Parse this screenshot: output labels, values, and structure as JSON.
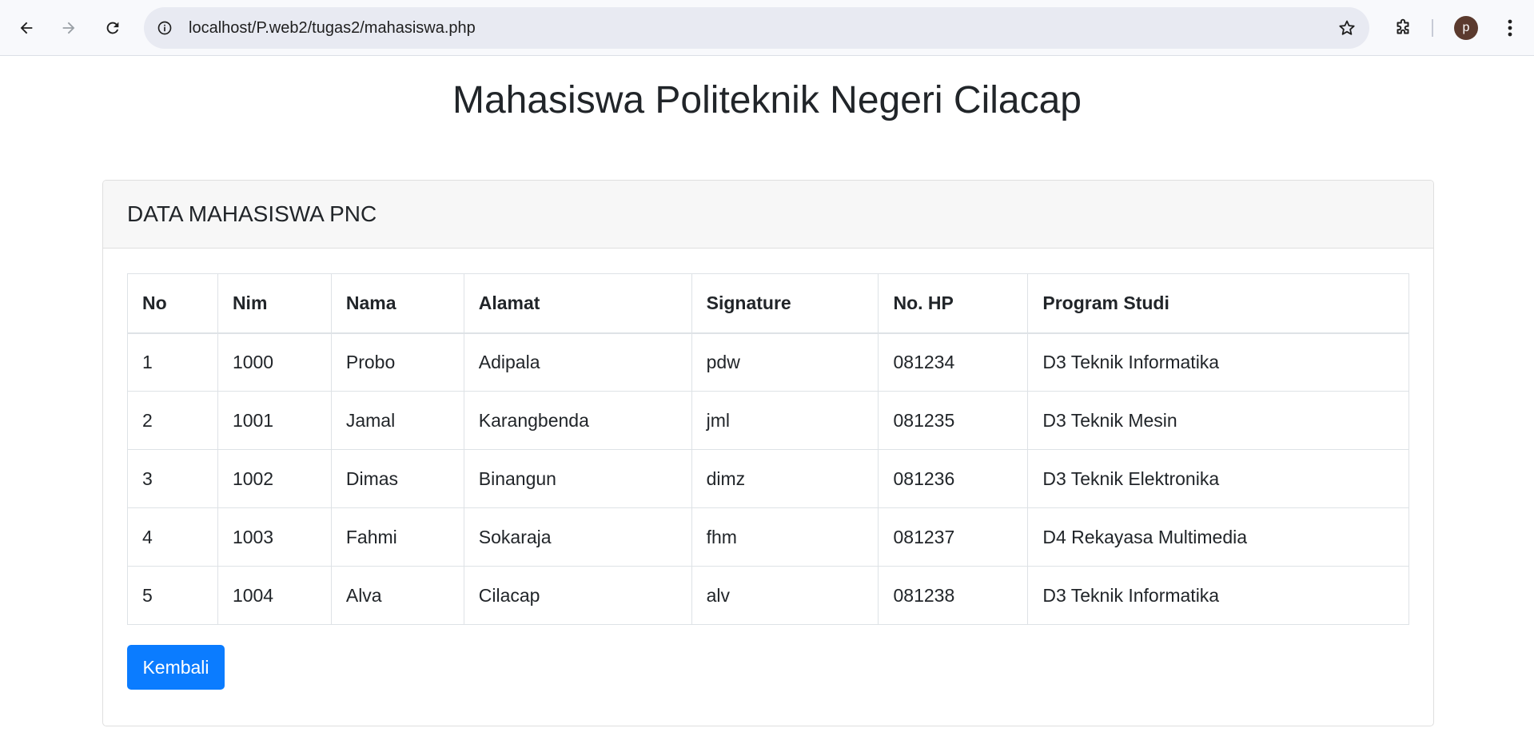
{
  "browser": {
    "url": "localhost/P.web2/tugas2/mahasiswa.php",
    "profile_initial": "p",
    "icons": {
      "back": "back-arrow-icon",
      "forward": "forward-arrow-icon",
      "reload": "reload-icon",
      "site_info": "site-info-icon",
      "bookmark": "star-icon",
      "extensions": "puzzle-icon",
      "menu": "kebab-menu-icon"
    }
  },
  "page": {
    "title": "Mahasiswa Politeknik Negeri Cilacap"
  },
  "card": {
    "header": "DATA MAHASISWA PNC",
    "table": {
      "columns": [
        "No",
        "Nim",
        "Nama",
        "Alamat",
        "Signature",
        "No. HP",
        "Program Studi"
      ],
      "rows": [
        [
          "1",
          "1000",
          "Probo",
          "Adipala",
          "pdw",
          "081234",
          "D3 Teknik Informatika"
        ],
        [
          "2",
          "1001",
          "Jamal",
          "Karangbenda",
          "jml",
          "081235",
          "D3 Teknik Mesin"
        ],
        [
          "3",
          "1002",
          "Dimas",
          "Binangun",
          "dimz",
          "081236",
          "D3 Teknik Elektronika"
        ],
        [
          "4",
          "1003",
          "Fahmi",
          "Sokaraja",
          "fhm",
          "081237",
          "D4 Rekayasa Multimedia"
        ],
        [
          "5",
          "1004",
          "Alva",
          "Cilacap",
          "alv",
          "081238",
          "D3 Teknik Informatika"
        ]
      ]
    },
    "back_button_label": "Kembali"
  },
  "colors": {
    "primary_button": "#0b7cff",
    "avatar": "#5b3a2e",
    "text": "#212529"
  }
}
